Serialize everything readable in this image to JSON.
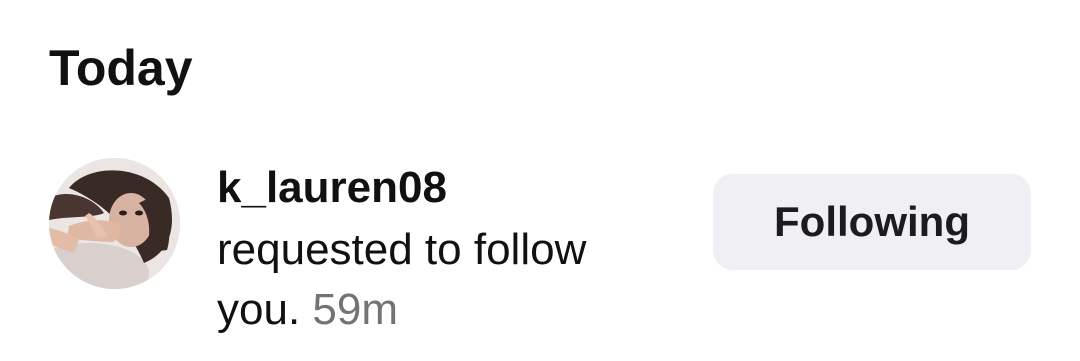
{
  "section": {
    "title": "Today"
  },
  "notification": {
    "avatar_icon": "profile-photo",
    "username": "k_lauren08",
    "message_part1": "requested to follow",
    "message_part2": "you.",
    "time": "59m",
    "button_label": "Following",
    "colors": {
      "button_bg": "#efeff4",
      "timestamp": "#737373",
      "text": "#111111"
    }
  }
}
